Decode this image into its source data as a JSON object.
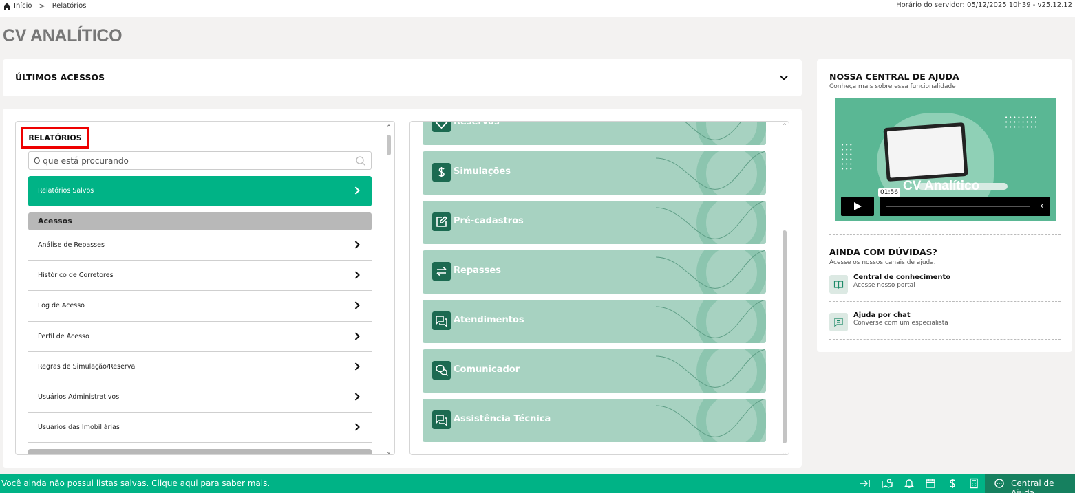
{
  "breadcrumb": {
    "home": "Início",
    "current": "Relatórios"
  },
  "server_time": "Horário do servidor: 05/12/2025 10h39 - v25.12.12",
  "page_title": "CV ANALÍTICO",
  "recent": {
    "title": "ÚLTIMOS ACESSOS",
    "icon": "chevron-down-icon"
  },
  "reports": {
    "title": "RELATÓRIOS",
    "search_placeholder": "O que está procurando",
    "saved_label": "Relatórios Salvos",
    "section": "Acessos",
    "items": [
      "Análise de Repasses",
      "Histórico de Corretores",
      "Log de Acesso",
      "Perfil de Acesso",
      "Regras de Simulação/Reserva",
      "Usuários Administrativos",
      "Usuários das Imobiliárias"
    ]
  },
  "modules": [
    {
      "label": "Reservas",
      "icon": "tag-icon"
    },
    {
      "label": "Simulações",
      "icon": "dollar-icon"
    },
    {
      "label": "Pré-cadastros",
      "icon": "edit-icon"
    },
    {
      "label": "Repasses",
      "icon": "transfer-icon"
    },
    {
      "label": "Atendimentos",
      "icon": "chat-icon"
    },
    {
      "label": "Comunicador",
      "icon": "messages-icon"
    },
    {
      "label": "Assistência Técnica",
      "icon": "chat-icon"
    }
  ],
  "help": {
    "title": "NOSSA CENTRAL DE AJUDA",
    "subtitle": "Conheça mais sobre essa funcionalidade",
    "video_brand": "CV Analítico",
    "video_time": "01:56",
    "doubts_title": "AINDA COM DÚVIDAS?",
    "doubts_subtitle": "Acesse os nossos canais de ajuda.",
    "channels": [
      {
        "title": "Central de conhecimento",
        "desc": "Acesse nosso portal",
        "icon": "book-icon"
      },
      {
        "title": "Ajuda por chat",
        "desc": "Converse com um especialista",
        "icon": "chat-icon"
      }
    ]
  },
  "footer": {
    "message": "Você ainda não possui listas salvas. Clique aqui para saber mais.",
    "help_label": "Central de Ajuda"
  },
  "colors": {
    "accent": "#00b386",
    "module_bg": "#a7d2c1",
    "icon_bg": "#1c6a51",
    "highlight": "#ee0000"
  }
}
